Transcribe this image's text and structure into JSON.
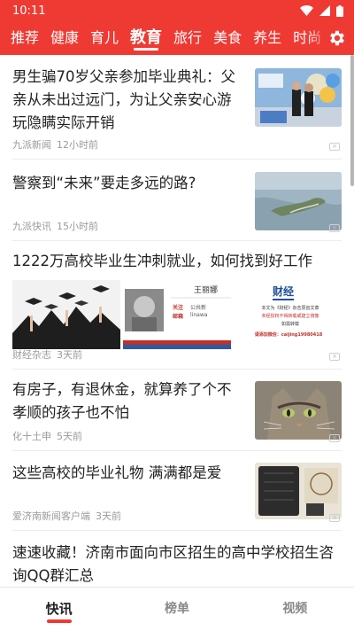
{
  "status": {
    "time": "10:11"
  },
  "tabs": [
    "推荐",
    "健康",
    "育儿",
    "教育",
    "旅行",
    "美食",
    "养生",
    "时尚"
  ],
  "active_tab": "教育",
  "articles": [
    {
      "title": "男生骗70岁父亲参加毕业典礼：父亲从未出过远门，为让父亲安心游玩隐瞒实际开销",
      "source": "九派新闻",
      "time": "12小时前"
    },
    {
      "title": "警察到“未来”要走多远的路?",
      "source": "九派快讯",
      "time": "15小时前"
    },
    {
      "title": "1222万高校毕业生冲刺就业，如何找到好工作",
      "source": "财经杂志",
      "time": "3天前",
      "gallery": {
        "profile_name": "王丽娜",
        "profile_lines": [
          "关注",
          "邮箱"
        ],
        "profile_values": [
          "公共新",
          "linawa"
        ],
        "brand": "财经",
        "ad_lines": [
          "本文为《财经》杂志原创文章",
          "未经授权不得转载或建立镜像",
          "如需转载",
          "请添加微信：caijing19980418"
        ]
      }
    },
    {
      "title": "有房子，有退休金，就算养了个不孝顺的孩子也不怕",
      "source": "化十土申",
      "time": "5天前"
    },
    {
      "title": "这些高校的毕业礼物 满满都是爱",
      "source": "爱济南新闻客户端",
      "time": "3天前"
    },
    {
      "title": "速速收藏！济南市面向市区招生的高中学校招生咨询QQ群汇总",
      "source": "",
      "time": ""
    }
  ],
  "bottom_nav": [
    "快讯",
    "榜单",
    "视频"
  ],
  "colors": {
    "accent": "#ef3a34"
  },
  "icons": [
    "wifi-icon",
    "signal-icon",
    "battery-icon",
    "gear-icon",
    "close-icon"
  ]
}
